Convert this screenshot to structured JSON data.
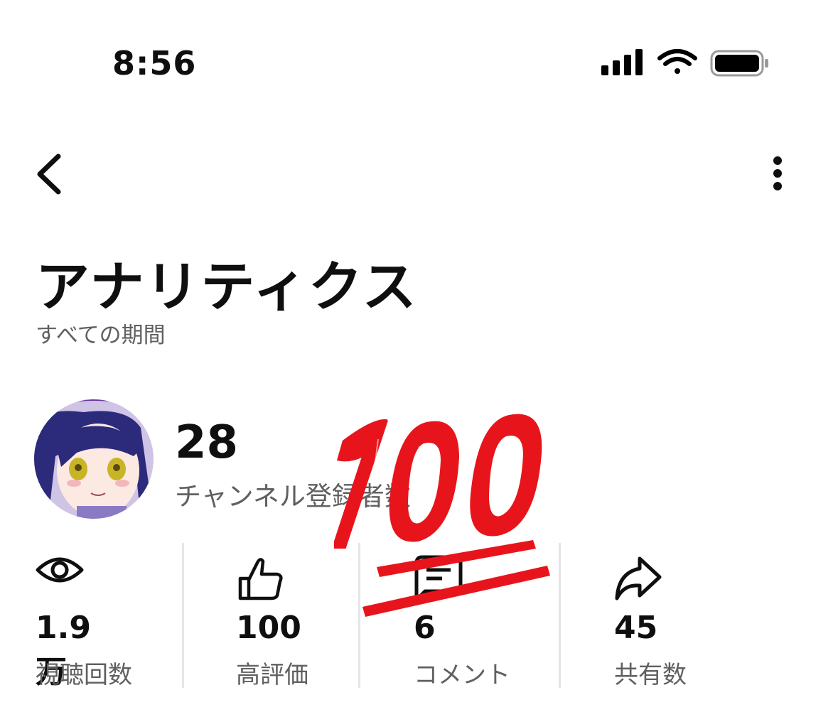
{
  "status_bar": {
    "time": "8:56",
    "icons": [
      "cellular-signal-icon",
      "wifi-icon",
      "battery-icon"
    ]
  },
  "nav": {
    "back_icon": "chevron-left-icon",
    "more_icon": "more-vertical-icon"
  },
  "header": {
    "title": "アナリティクス",
    "period": "すべての期間"
  },
  "channel": {
    "subscriber_count": "28",
    "subscriber_label": "チャンネル登録者数"
  },
  "stats": [
    {
      "icon": "eye-icon",
      "value": "1.9万",
      "label": "視聴回数"
    },
    {
      "icon": "thumbs-up-icon",
      "value": "100",
      "label": "高評価"
    },
    {
      "icon": "comment-icon",
      "value": "6",
      "label": "コメント"
    },
    {
      "icon": "share-icon",
      "value": "45",
      "label": "共有数"
    }
  ],
  "overlay": {
    "emoji": "hundred-points-emoji",
    "text": "100"
  },
  "colors": {
    "text": "#0f0f0f",
    "secondary_text": "#606060",
    "emoji_red": "#e8141c"
  }
}
